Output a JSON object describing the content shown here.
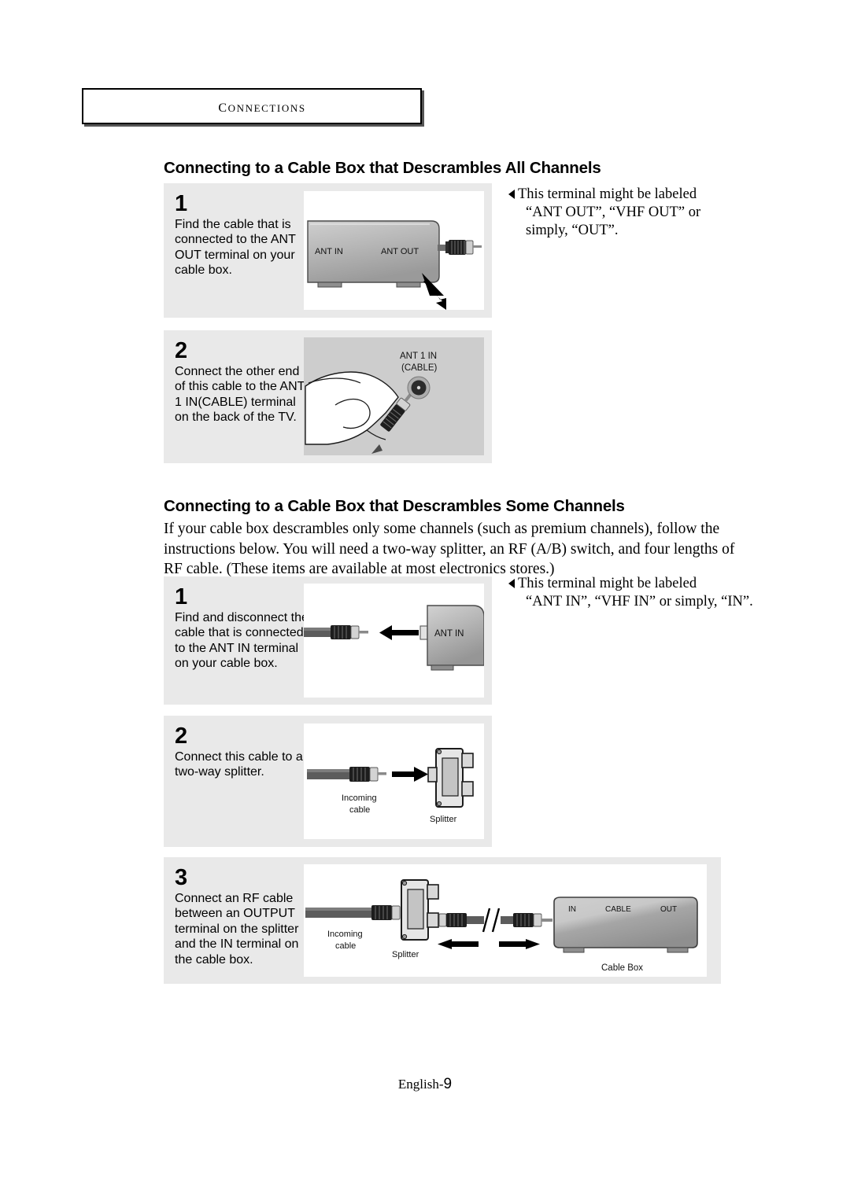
{
  "chapter": {
    "title": "Connections"
  },
  "sections": [
    {
      "heading": "Connecting to a Cable Box that Descrambles All Channels",
      "steps": [
        {
          "number": "1",
          "text": "Find the cable that is connected to the ANT OUT terminal on your cable box.",
          "art_labels": {
            "ant_in": "ANT IN",
            "ant_out": "ANT OUT"
          }
        },
        {
          "number": "2",
          "text": "Connect the other end of this cable to the ANT 1 IN(CABLE) terminal on the back of the TV.",
          "art_labels": {
            "terminal_line1": "ANT 1 IN",
            "terminal_line2": "(CABLE)"
          }
        }
      ],
      "callout": {
        "line1": "This terminal might be labeled",
        "line2": "“ANT OUT”, “VHF OUT” or",
        "line3": "simply, “OUT”."
      }
    },
    {
      "heading": "Connecting to a Cable Box that Descrambles Some Channels",
      "intro": "If your cable box descrambles only some channels (such as premium channels), follow the instructions below. You will need a two-way splitter, an RF (A/B) switch, and four lengths of RF cable. (These items are available at most electronics stores.)",
      "steps": [
        {
          "number": "1",
          "text": "Find and disconnect the cable that is connected to the ANT IN terminal on your cable box.",
          "art_labels": {
            "ant_in": "ANT IN"
          }
        },
        {
          "number": "2",
          "text": "Connect this cable to a two-way splitter.",
          "art_labels": {
            "incoming_line1": "Incoming",
            "incoming_line2": "cable",
            "splitter": "Splitter"
          }
        },
        {
          "number": "3",
          "text": "Connect an RF cable between an OUTPUT terminal on the splitter and the IN terminal on the cable box.",
          "art_labels": {
            "incoming_line1": "Incoming",
            "incoming_line2": "cable",
            "splitter": "Splitter",
            "box_in": "IN",
            "box_cable": "CABLE",
            "box_out": "OUT",
            "cable_box": "Cable Box"
          }
        }
      ],
      "callout": {
        "line1": "This terminal might be labeled",
        "line2": "“ANT IN”, “VHF IN” or simply, “IN”."
      }
    }
  ],
  "footer": {
    "label": "English-",
    "page": "9"
  },
  "colors": {
    "panel_background": "#e9e9e9",
    "art_background": "#ffffff",
    "device_light": "#d9d9d9",
    "device_dark": "#8f8f8f",
    "cable": "#585858",
    "ink": "#000000"
  }
}
